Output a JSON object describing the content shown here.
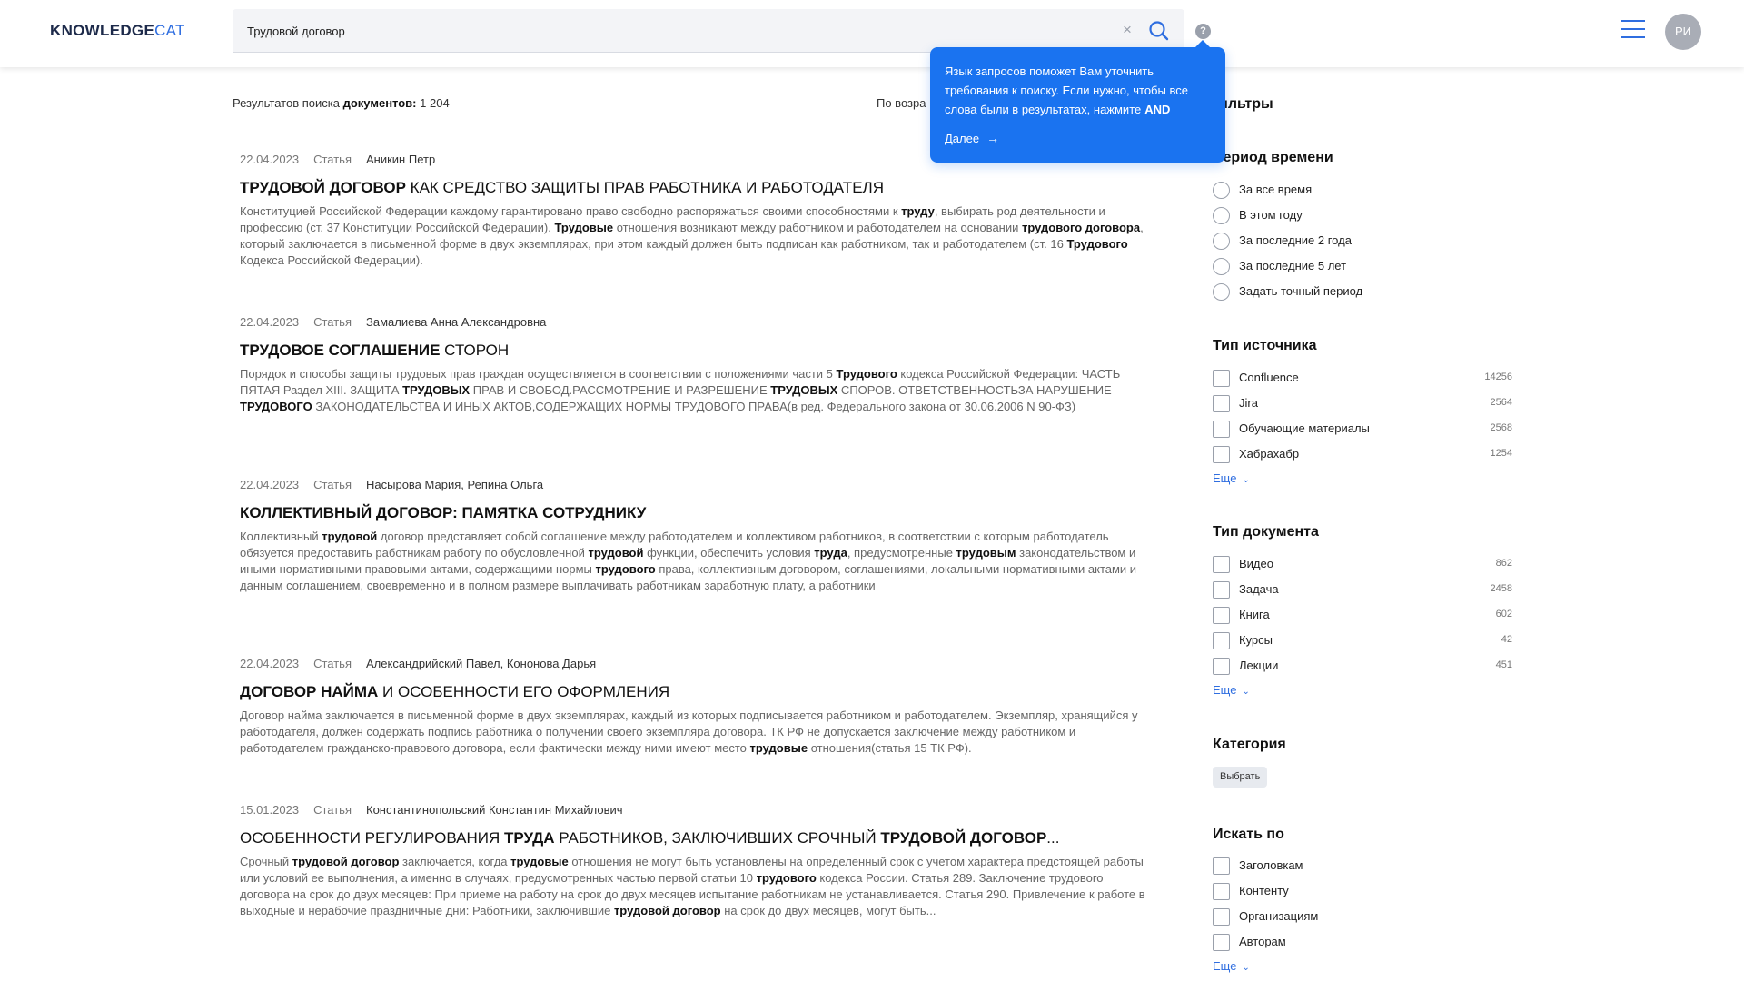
{
  "header": {
    "logo_bold": "KNOWLEDGE",
    "logo_light": "CAT",
    "search_value": "Трудовой договор",
    "clear_glyph": "×",
    "help_glyph": "?",
    "avatar": "РИ"
  },
  "tooltip": {
    "text": "Язык запросов поможет Вам уточнить требования к поиску. Если нужно, чтобы все слова были в результатах, нажмите",
    "keyword": "AND",
    "next_label": "Далее",
    "next_arrow": "→"
  },
  "summary": {
    "prefix": "Результатов поиска",
    "bold": "документов:",
    "count": "1 204"
  },
  "sort_label": "По возра",
  "results": [
    {
      "date": "22.04.2023",
      "type": "Статья",
      "author": "Аникин Петр",
      "title_bold": "Трудовой договор",
      "title_rest": " как средство защиты прав работника и работодателя",
      "snippet": [
        {
          "t": "Конституцией Российской Федерации каждому гарантировано право свободно распоряжаться своими способностями к ",
          "b": false
        },
        {
          "t": "труду",
          "b": true
        },
        {
          "t": ", выбирать род деятельности и профессию (ст. 37 Конституции Российской Федерации). ",
          "b": false
        },
        {
          "t": "Трудовые",
          "b": true
        },
        {
          "t": " отношения возникают между работником и работодателем на основании ",
          "b": false
        },
        {
          "t": "трудового договора",
          "b": true
        },
        {
          "t": ", который заключается в письменной форме в двух экземплярах, при этом каждый должен быть подписан как работником, так и работодателем (ст. 16 ",
          "b": false
        },
        {
          "t": "Трудового",
          "b": true
        },
        {
          "t": " Кодекса Российской Федерации).",
          "b": false
        }
      ]
    },
    {
      "date": "22.04.2023",
      "type": "Статья",
      "author": "Замалиева Анна Александровна",
      "title_bold": "Трудовое соглашение",
      "title_rest": " сторон",
      "snippet": [
        {
          "t": "Порядок и способы защиты трудовых прав граждан осуществляется в соответствии с положениями части 5 ",
          "b": false
        },
        {
          "t": "Трудового",
          "b": true
        },
        {
          "t": " кодекса Российской Федерации: ЧАСТЬ ПЯТАЯ Раздел XIII. ЗАЩИТА ",
          "b": false
        },
        {
          "t": "ТРУДОВЫХ",
          "b": true
        },
        {
          "t": " ПРАВ И СВОБОД.РАССМОТРЕНИЕ И РАЗРЕШЕНИЕ ",
          "b": false
        },
        {
          "t": "ТРУДОВЫХ",
          "b": true
        },
        {
          "t": " СПОРОВ. ОТВЕТСТВЕННОСТЬЗА НАРУШЕНИЕ ",
          "b": false
        },
        {
          "t": "ТРУДОВОГО",
          "b": true
        },
        {
          "t": " ЗАКОНОДАТЕЛЬСТВА И ИНЫХ АКТОВ,СОДЕРЖАЩИХ НОРМЫ ТРУДОВОГО ПРАВА(в ред. Федерального закона от 30.06.2006 N 90-ФЗ)",
          "b": false
        }
      ]
    },
    {
      "date": "22.04.2023",
      "type": "Статья",
      "author": "Насырова Мария, Репина Ольга",
      "title_bold": "Коллективный договор: памятка сотруднику",
      "title_rest": "",
      "snippet": [
        {
          "t": "Коллективный ",
          "b": false
        },
        {
          "t": "трудовой",
          "b": true
        },
        {
          "t": " договор представляет собой соглашение между работодателем и коллективом работников, в соответствии с которым работодатель обязуется предоставить работникам работу по обусловленной ",
          "b": false
        },
        {
          "t": "трудовой",
          "b": true
        },
        {
          "t": " функции, обеспечить условия ",
          "b": false
        },
        {
          "t": "труда",
          "b": true
        },
        {
          "t": ", предусмотренные ",
          "b": false
        },
        {
          "t": "трудовым",
          "b": true
        },
        {
          "t": " законодательством и иными нормативными правовыми актами, содержащими нормы ",
          "b": false
        },
        {
          "t": "трудового",
          "b": true
        },
        {
          "t": " права, коллективным договором, соглашениями, локальными нормативными актами и данным соглашением, своевременно и в полном размере выплачивать работникам заработную плату, а работники",
          "b": false
        }
      ]
    },
    {
      "date": "22.04.2023",
      "type": "Статья",
      "author": "Александрийский Павел, Кононова Дарья",
      "title_bold": "Договор найма",
      "title_rest": " и особенности его оформления",
      "snippet": [
        {
          "t": "Договор найма заключается в письменной форме в двух экземплярах, каждый из которых подписывается работником и работодателем. Экземпляр, хранящийся у работодателя, должен содержать подпись работника о получении своего экземпляра договора. ТК РФ не допускается заключение между работником и работодателем гражданско-правового договора, если фактически между ними имеют место ",
          "b": false
        },
        {
          "t": "трудовые",
          "b": true
        },
        {
          "t": " отношения(статья 15 ТК РФ).",
          "b": false
        }
      ]
    },
    {
      "date": "15.01.2023",
      "type": "Статья",
      "author": "Константинопольский Константин Михайлович",
      "title_parts": [
        {
          "t": "Особенности регулирования ",
          "b": false
        },
        {
          "t": "труда",
          "b": true
        },
        {
          "t": " работников, заключивших срочный ",
          "b": false
        },
        {
          "t": "трудовой договор",
          "b": true
        },
        {
          "t": "...",
          "b": false
        }
      ],
      "snippet": [
        {
          "t": "Срочный ",
          "b": false
        },
        {
          "t": "трудовой договор",
          "b": true
        },
        {
          "t": " заключается, когда ",
          "b": false
        },
        {
          "t": "трудовые",
          "b": true
        },
        {
          "t": " отношения не могут быть установлены на определенный срок с учетом характера предстоящей работы или условий ее выполнения, а именно в случаях, предусмотренных частью первой статьи 10 ",
          "b": false
        },
        {
          "t": "трудового",
          "b": true
        },
        {
          "t": " кодекса России. Статья 289. Заключение трудового договора на срок до двух месяцев: При приеме на работу на срок до двух месяцев испытание работникам не устанавливается. Статья 290. Привлечение к работе в выходные и нерабочие праздничные дни: Работники, заключившие ",
          "b": false
        },
        {
          "t": "трудовой договор",
          "b": true
        },
        {
          "t": " на срок до двух месяцев, могут быть...",
          "b": false
        }
      ]
    }
  ],
  "filters": {
    "title": "Фильтры",
    "title_visible": "ильтры",
    "period": {
      "title": "Период времени",
      "options": [
        "За все время",
        "В этом году",
        "За последние 2 года",
        "За последние 5 лет",
        "Задать точный период"
      ]
    },
    "source": {
      "title": "Тип источника",
      "options": [
        {
          "label": "Confluence",
          "count": "14256"
        },
        {
          "label": "Jira",
          "count": "2564"
        },
        {
          "label": "Обучающие материалы",
          "count": "2568"
        },
        {
          "label": "Хабрахабр",
          "count": "1254"
        }
      ],
      "more": "Еще"
    },
    "doctype": {
      "title": "Тип документа",
      "options": [
        {
          "label": "Видео",
          "count": "862"
        },
        {
          "label": "Задача",
          "count": "2458"
        },
        {
          "label": "Книга",
          "count": "602"
        },
        {
          "label": "Курсы",
          "count": "42"
        },
        {
          "label": "Лекции",
          "count": "451"
        }
      ],
      "more": "Еще"
    },
    "category": {
      "title": "Категория",
      "button": "Выбрать"
    },
    "searchby": {
      "title": "Искать по",
      "options": [
        "Заголовкам",
        "Контенту",
        "Организациям",
        "Авторам"
      ],
      "more": "Еще"
    },
    "chevron": "⌄"
  }
}
